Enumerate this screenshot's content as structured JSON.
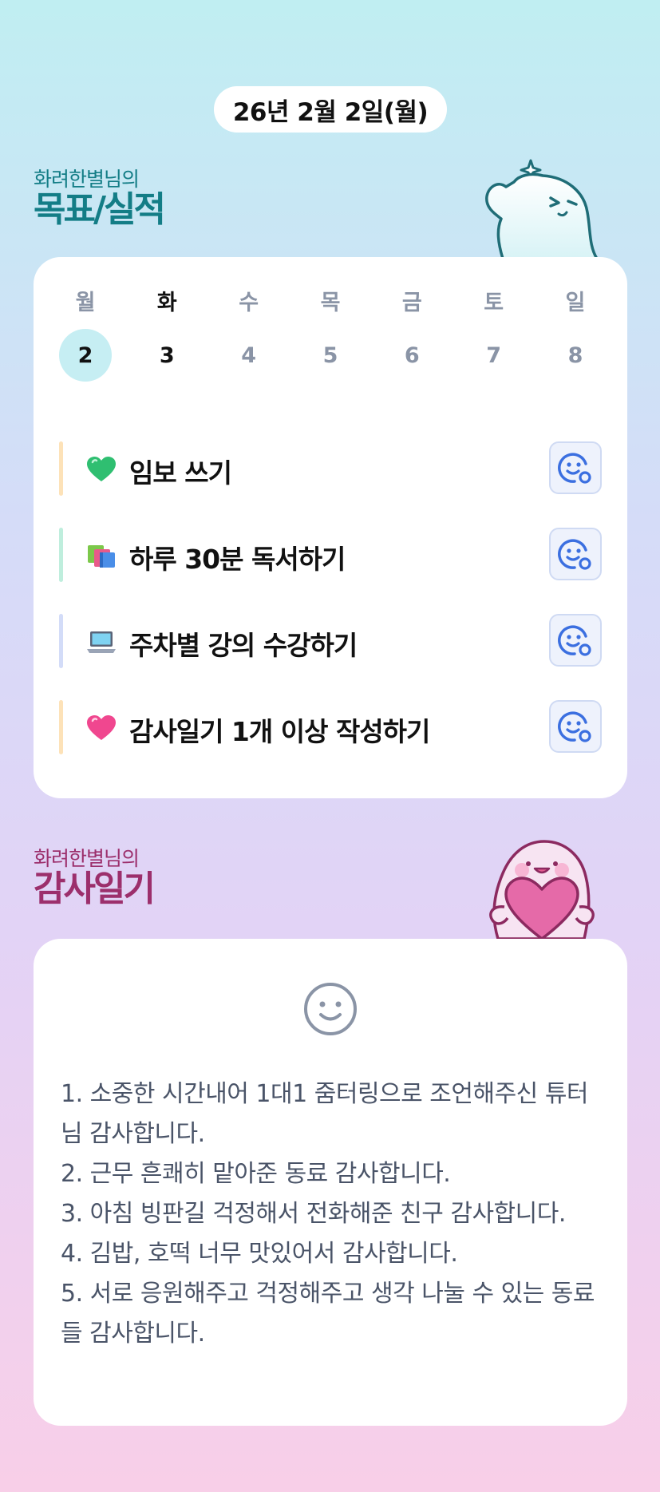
{
  "header": {
    "date": "26년 2월 2일(월)"
  },
  "goals_section": {
    "owner": "화려한별님의",
    "title": "목표/실적"
  },
  "week": [
    {
      "name": "월",
      "num": "2"
    },
    {
      "name": "화",
      "num": "3"
    },
    {
      "name": "수",
      "num": "4"
    },
    {
      "name": "목",
      "num": "5"
    },
    {
      "name": "금",
      "num": "6"
    },
    {
      "name": "토",
      "num": "7"
    },
    {
      "name": "일",
      "num": "8"
    }
  ],
  "goals": [
    {
      "label": "임보 쓰기",
      "icon": "green-heart-icon",
      "bar_color": "#fde2b8"
    },
    {
      "label": "하루 30분 독서하기",
      "icon": "books-icon",
      "bar_color": "#bfeedd"
    },
    {
      "label": "주차별 강의 수강하기",
      "icon": "laptop-icon",
      "bar_color": "#d3dcf8"
    },
    {
      "label": "감사일기 1개 이상 작성하기",
      "icon": "pink-heart-icon",
      "bar_color": "#fde2b8"
    }
  ],
  "gratitude_section": {
    "owner": "화려한별님의",
    "title": "감사일기"
  },
  "diary": {
    "lines": [
      "1. 소중한 시간내어 1대1 줌터링으로 조언해주신 튜터님 감사합니다.",
      "2. 근무 흔쾌히 맡아준 동료 감사합니다.",
      "3. 아침 빙판길 걱정해서 전화해준 친구 감사합니다.",
      "4. 김밥, 호떡 너무 맛있어서 감사합니다.",
      "5. 서로 응원해주고 걱정해주고 생각 나눌 수 있는 동료들 감사합니다."
    ]
  },
  "colors": {
    "goals_title": "#137d86",
    "gratitude_title": "#9c2f6c",
    "selected_day": "#c6eef3",
    "reaction_icon": "#3b6fe0"
  }
}
